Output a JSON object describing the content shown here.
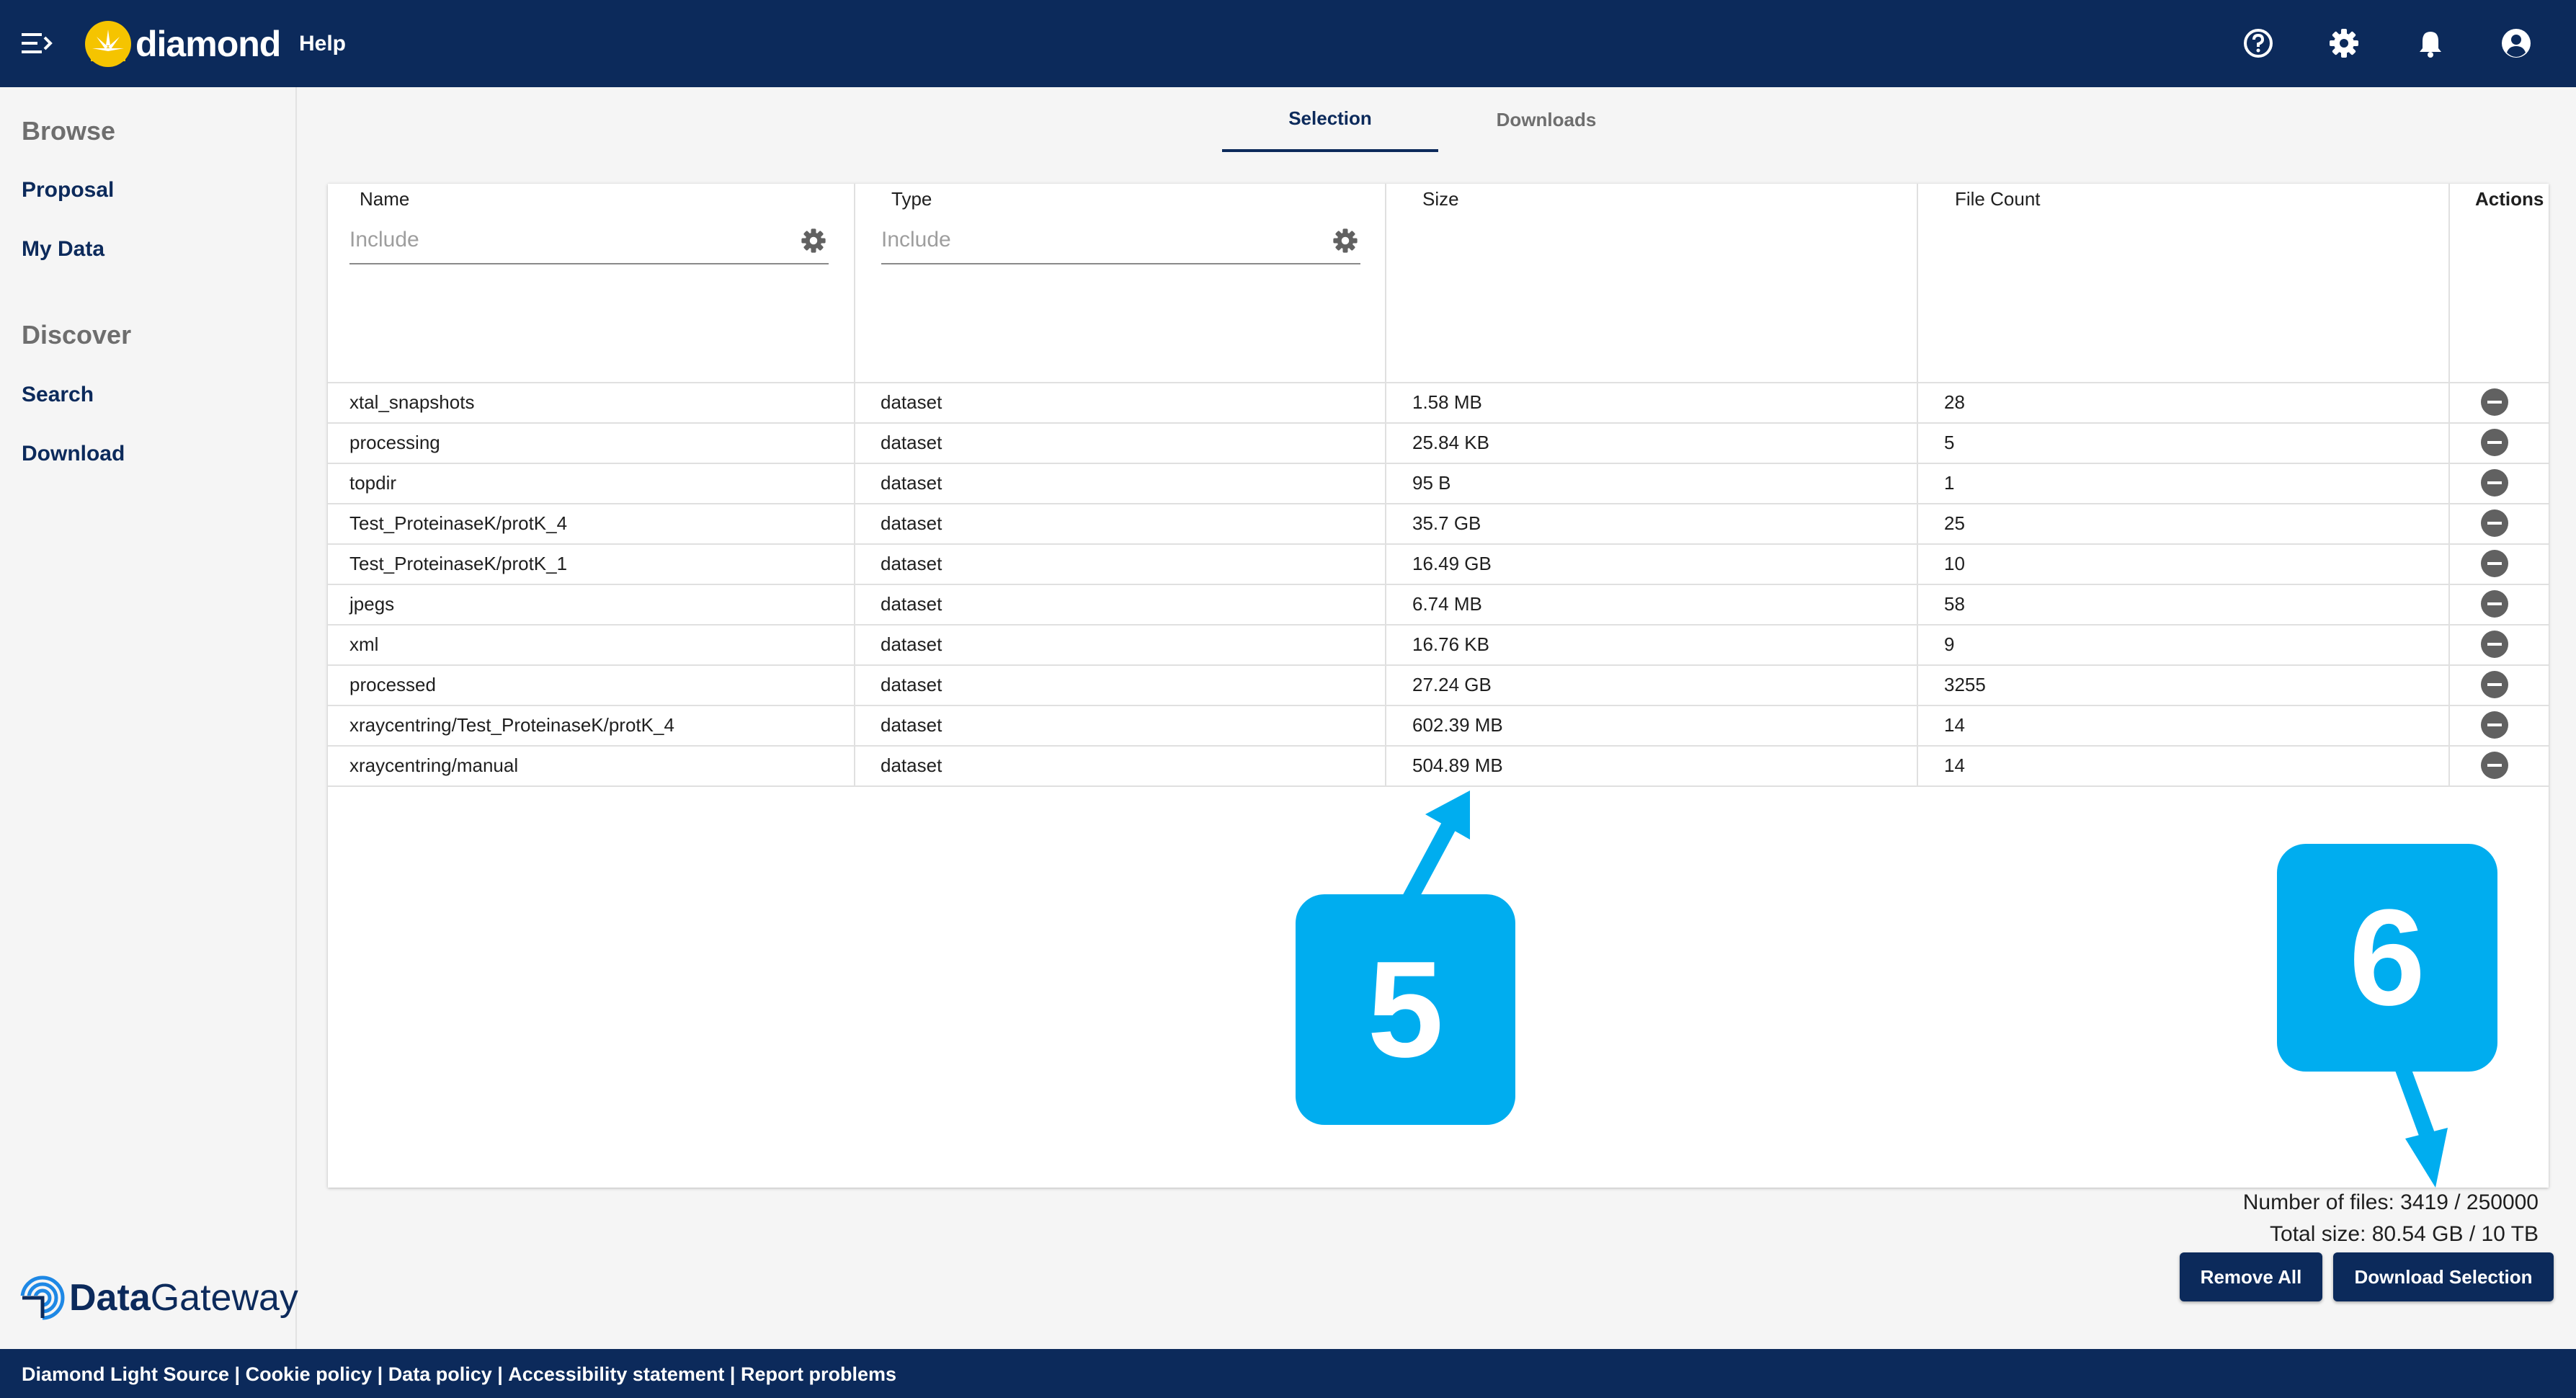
{
  "app": {
    "logo_text": "diamond",
    "help_label": "Help",
    "icons": [
      "help-icon",
      "settings-icon",
      "notifications-icon",
      "account-icon"
    ]
  },
  "sidebar": {
    "browse_heading": "Browse",
    "browse_items": [
      {
        "label": "Proposal"
      },
      {
        "label": "My Data"
      }
    ],
    "discover_heading": "Discover",
    "discover_items": [
      {
        "label": "Search"
      },
      {
        "label": "Download"
      }
    ],
    "brand_bold": "Data",
    "brand_light": "Gateway"
  },
  "tabs": [
    {
      "label": "Selection",
      "active": true
    },
    {
      "label": "Downloads",
      "active": false
    }
  ],
  "table": {
    "columns": [
      {
        "label": "Name",
        "filter_placeholder": "Include"
      },
      {
        "label": "Type",
        "filter_placeholder": "Include"
      },
      {
        "label": "Size"
      },
      {
        "label": "File Count"
      },
      {
        "label": "Actions"
      }
    ],
    "rows": [
      {
        "name": "xtal_snapshots",
        "type": "dataset",
        "size": "1.58 MB",
        "count": "28"
      },
      {
        "name": "processing",
        "type": "dataset",
        "size": "25.84 KB",
        "count": "5"
      },
      {
        "name": "topdir",
        "type": "dataset",
        "size": "95 B",
        "count": "1"
      },
      {
        "name": "Test_ProteinaseK/protK_4",
        "type": "dataset",
        "size": "35.7 GB",
        "count": "25"
      },
      {
        "name": "Test_ProteinaseK/protK_1",
        "type": "dataset",
        "size": "16.49 GB",
        "count": "10"
      },
      {
        "name": "jpegs",
        "type": "dataset",
        "size": "6.74 MB",
        "count": "58"
      },
      {
        "name": "xml",
        "type": "dataset",
        "size": "16.76 KB",
        "count": "9"
      },
      {
        "name": "processed",
        "type": "dataset",
        "size": "27.24 GB",
        "count": "3255"
      },
      {
        "name": "xraycentring/Test_ProteinaseK/protK_4",
        "type": "dataset",
        "size": "602.39 MB",
        "count": "14"
      },
      {
        "name": "xraycentring/manual",
        "type": "dataset",
        "size": "504.89 MB",
        "count": "14"
      }
    ]
  },
  "summary": {
    "files": "Number of files: 3419 / 250000",
    "size": "Total size: 80.54 GB / 10 TB"
  },
  "buttons": {
    "remove_all": "Remove All",
    "download_selection": "Download Selection"
  },
  "callouts": {
    "five": "5",
    "six": "6",
    "color": "#00adef"
  },
  "footer": {
    "links": [
      "Diamond Light Source",
      "Cookie policy",
      "Data policy",
      "Accessibility statement",
      "Report problems"
    ],
    "separator": " | "
  },
  "colors": {
    "brand_navy": "#0c2a5b",
    "accent_cyan": "#00adef"
  }
}
